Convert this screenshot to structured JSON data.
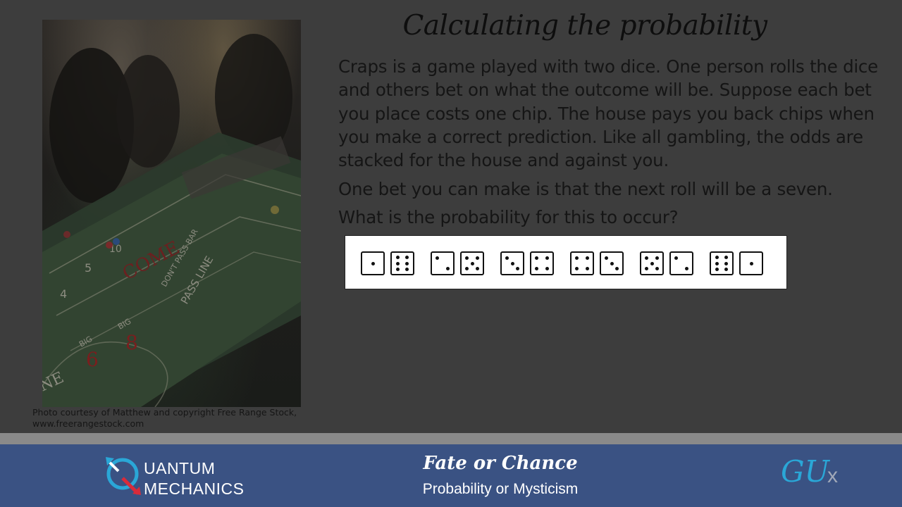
{
  "slide": {
    "title": "Calculating the probability",
    "paragraphs": [
      "Craps is a game played with two dice. One person rolls the dice and others bet on what the outcome will be. Suppose each bet you place costs one chip. The house pays you back chips when you make a correct prediction. Like all gambling, the odds are stacked for the house and against you.",
      "One bet you can make is that the next roll will be a seven.",
      "What is the probability for this to occur?"
    ],
    "photo_caption": "Photo courtesy of Matthew and copyright Free Range Stock, www.freerangestock.com",
    "photo_table_labels": [
      "COME",
      "PASS LINE",
      "DON'T PASS BAR",
      "BIG",
      "6",
      "8",
      "4",
      "5",
      "10",
      "NE"
    ],
    "dice_pairs": [
      [
        1,
        6
      ],
      [
        2,
        5
      ],
      [
        3,
        4
      ],
      [
        4,
        3
      ],
      [
        5,
        2
      ],
      [
        6,
        1
      ]
    ]
  },
  "footer": {
    "logo_left_text": [
      "UANTUM",
      "MECHANICS"
    ],
    "title": "Fate or Chance",
    "subtitle": "Probability or Mysticism",
    "logo_right_main": "GU",
    "logo_right_x": "x"
  },
  "colors": {
    "background": "#3d3d3d",
    "footer": "#3a5283",
    "accent_blue": "#2aa7d7",
    "logo_red": "#d92b3a"
  }
}
